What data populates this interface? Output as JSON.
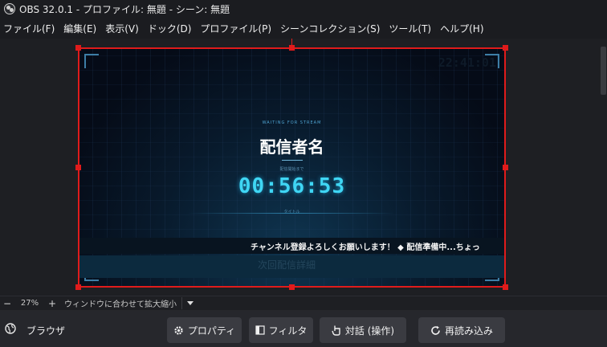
{
  "window": {
    "title": "OBS 32.0.1 - プロファイル: 無題 - シーン: 無題"
  },
  "menu": {
    "items": [
      "ファイル(F)",
      "編集(E)",
      "表示(V)",
      "ドック(D)",
      "プロファイル(P)",
      "シーンコレクション(S)",
      "ツール(T)",
      "ヘルプ(H)"
    ]
  },
  "preview": {
    "clock": "22:41:01",
    "waiting_text": "WAITING FOR STREAM",
    "streamer_name": "配信者名",
    "until_text": "配信開始まで",
    "countdown": "00:56:53",
    "caption": "タイトル",
    "ticker": "チャンネル登録よろしくお願いします！ ◆ 配信準備中...ちょっ",
    "info": "次回配信詳細"
  },
  "zoom": {
    "minus": "−",
    "level": "27%",
    "plus": "+",
    "fit_label": "ウィンドウに合わせて拡大縮小"
  },
  "source": {
    "name": "ブラウザ",
    "icon": "globe-icon"
  },
  "buttons": {
    "properties": {
      "label": "プロパティ",
      "icon": "gear-icon"
    },
    "filters": {
      "label": "フィルタ",
      "icon": "filter-icon"
    },
    "interact": {
      "label": "対話 (操作)",
      "icon": "hand-pointer-icon"
    },
    "reload": {
      "label": "再読み込み",
      "icon": "reload-icon"
    }
  },
  "colors": {
    "selection": "#e01b1b",
    "timer": "#3fd6f4",
    "background": "#1e1f23"
  }
}
